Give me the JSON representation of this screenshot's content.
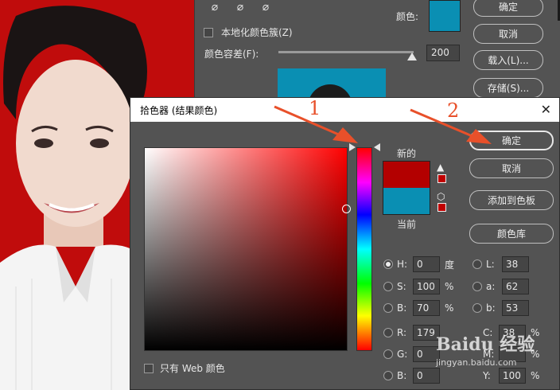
{
  "back_dialog": {
    "color_label": "颜色:",
    "localized_clusters_label": "本地化颜色簇(Z)",
    "fuzziness_label": "颜色容差(F):",
    "fuzziness_value": "200",
    "buttons": [
      "确定",
      "取消",
      "载入(L)...",
      "存储(S)..."
    ],
    "selected_color": "#0a8fb3"
  },
  "picker": {
    "title": "拾色器 (结果颜色)",
    "close_glyph": "✕",
    "new_label": "新的",
    "current_label": "当前",
    "web_only_label": "只有 Web 颜色",
    "new_color": "#b30000",
    "current_color": "#0a8fb3",
    "buttons": {
      "ok": "确定",
      "cancel": "取消",
      "add_swatch": "添加到色板",
      "libraries": "颜色库"
    },
    "hsb": [
      {
        "label": "H:",
        "value": "0",
        "unit": "度",
        "selected": true
      },
      {
        "label": "S:",
        "value": "100",
        "unit": "%",
        "selected": false
      },
      {
        "label": "B:",
        "value": "70",
        "unit": "%",
        "selected": false
      }
    ],
    "rgb": [
      {
        "label": "R:",
        "value": "179"
      },
      {
        "label": "G:",
        "value": "0"
      },
      {
        "label": "B:",
        "value": "0"
      }
    ],
    "lab": [
      {
        "label": "L:",
        "value": "38"
      },
      {
        "label": "a:",
        "value": "62"
      },
      {
        "label": "b:",
        "value": "53"
      }
    ],
    "cmyk": [
      {
        "label": "C:",
        "value": "38",
        "unit": "%"
      },
      {
        "label": "M:",
        "value": "",
        "unit": "%"
      },
      {
        "label": "Y:",
        "value": "100",
        "unit": "%"
      }
    ]
  },
  "annotations": {
    "marker_1": "1",
    "marker_2": "2",
    "arrow_color": "#e8502a"
  },
  "watermark": {
    "logo": "Baidu 经验",
    "url": "jingyan.baidu.com"
  }
}
